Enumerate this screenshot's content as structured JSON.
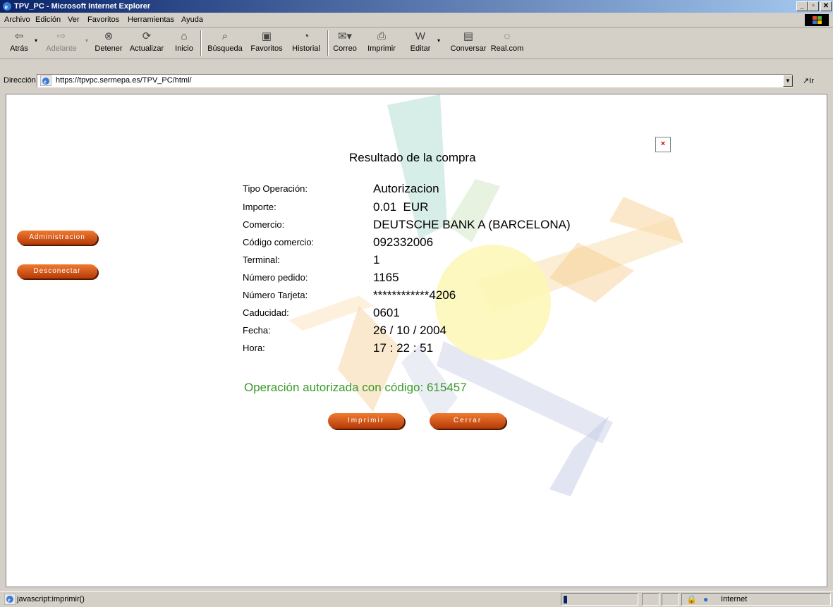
{
  "window": {
    "title": "TPV_PC - Microsoft Internet Explorer"
  },
  "menu": [
    "Archivo",
    "Edición",
    "Ver",
    "Favoritos",
    "Herramientas",
    "Ayuda"
  ],
  "toolbar": {
    "atras": "Atrás",
    "adelante": "Adelante",
    "detener": "Detener",
    "actualizar": "Actualizar",
    "inicio": "Inicio",
    "busqueda": "Búsqueda",
    "favoritos": "Favoritos",
    "historial": "Historial",
    "correo": "Correo",
    "imprimir": "Imprimir",
    "editar": "Editar",
    "conversar": "Conversar",
    "realcom": "Real.com"
  },
  "address": {
    "label": "Dirección",
    "url": "https://tpvpc.sermepa.es/TPV_PC/html/",
    "go": "Ir"
  },
  "sidebar": {
    "admin": "Administracion",
    "logout": "Desconectar"
  },
  "page": {
    "heading": "Resultado de la compra",
    "auth_message": "Operación autorizada con código: 615457",
    "print_button": "Imprimir",
    "close_button": "Cerrar"
  },
  "fields": [
    {
      "label": "Tipo Operación:",
      "value": "Autorizacion"
    },
    {
      "label": "Importe:",
      "value": "0.01  EUR"
    },
    {
      "label": "Comercio:",
      "value": "DEUTSCHE BANK A (BARCELONA)"
    },
    {
      "label": "Código comercio:",
      "value": "092332006"
    },
    {
      "label": "Terminal:",
      "value": "1"
    },
    {
      "label": "Número pedido:",
      "value": "1165"
    },
    {
      "label": "Número Tarjeta:",
      "value": "************4206"
    },
    {
      "label": "Caducidad:",
      "value": "0601"
    },
    {
      "label": "Fecha:",
      "value": "26 / 10 / 2004"
    },
    {
      "label": "Hora:",
      "value": "17 : 22 : 51"
    }
  ],
  "status": {
    "text": "javascript:imprimir()",
    "zone": "Internet"
  }
}
